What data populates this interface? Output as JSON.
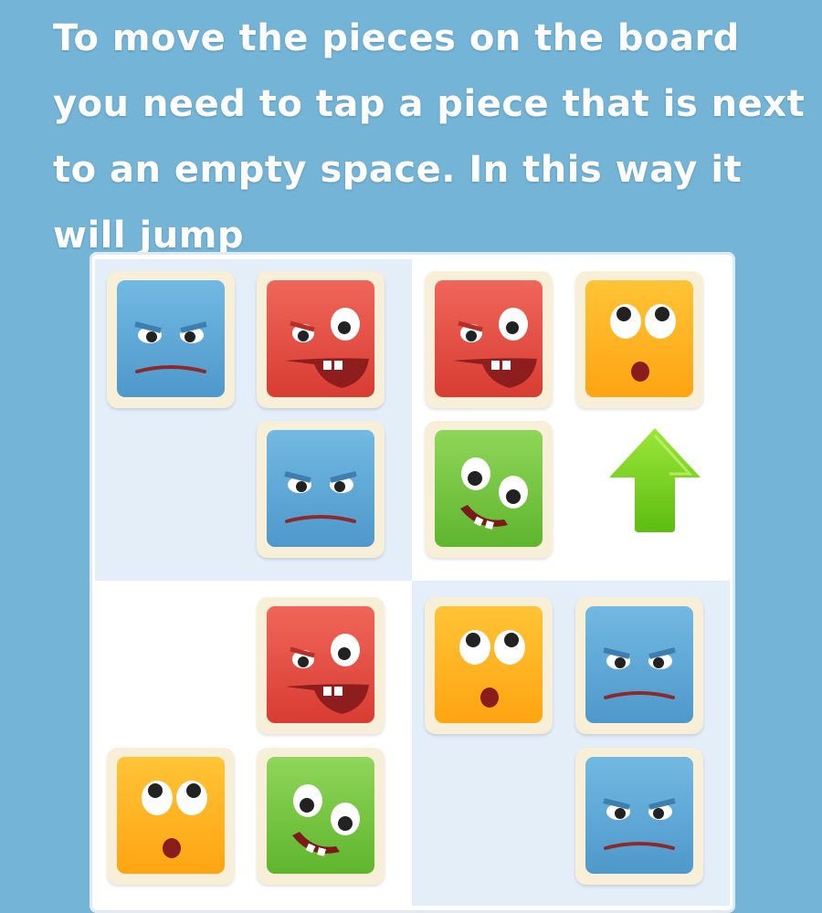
{
  "tutorial": {
    "instruction_text": "To move the pieces on the board you need to tap a piece that is next to an empty space. In this way it will jump"
  },
  "colors": {
    "background": "#74b4d6",
    "blue": "#5aa7d6",
    "red": "#e8483c",
    "yellow": "#ffb020",
    "green": "#74c83a",
    "arrow": "#7ad11c"
  },
  "board": {
    "rows": [
      [
        "blue-angry",
        "red-grin",
        "red-grin",
        "yellow-surprised"
      ],
      [
        "empty",
        "blue-angry",
        "green-happy",
        "arrow-up"
      ],
      [
        "empty",
        "red-grin",
        "yellow-surprised",
        "blue-angry"
      ],
      [
        "yellow-surprised",
        "green-happy",
        "empty",
        "blue-angry"
      ]
    ]
  }
}
